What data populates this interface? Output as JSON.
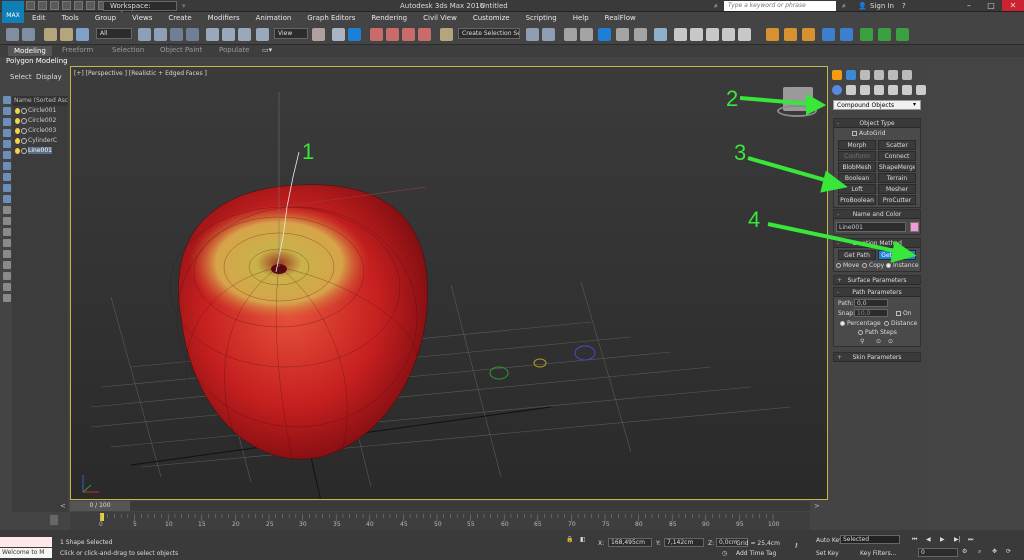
{
  "titlebar": {
    "logo": "MAX",
    "workspace": "Workspace: Default",
    "app_title": "Autodesk 3ds Max 2016",
    "document": "Untitled",
    "search_placeholder": "Type a keyword or phrase",
    "sign_in": "Sign In"
  },
  "menu": [
    "Edit",
    "Tools",
    "Group",
    "Views",
    "Create",
    "Modifiers",
    "Animation",
    "Graph Editors",
    "Rendering",
    "Civil View",
    "Customize",
    "Scripting",
    "Help",
    "RealFlow"
  ],
  "toolbar": {
    "selection_filter": "All",
    "ref_coord": "View",
    "named_selection": "Create Selection Se"
  },
  "ribbon": {
    "tabs": [
      "Modeling",
      "Freeform",
      "Selection",
      "Object Paint",
      "Populate"
    ],
    "active": "Modeling",
    "subtitle": "Polygon Modeling"
  },
  "left_panel": {
    "tabs": [
      "Select",
      "Display"
    ],
    "header": "Name (Sorted Ascen",
    "items": [
      "Circle001",
      "Circle002",
      "Circle003",
      "CylinderC",
      "Line001"
    ],
    "selected_index": 4
  },
  "viewport": {
    "label": "[+] [Perspective ] [Realistic + Edged Faces ]"
  },
  "command_panel": {
    "category": "Compound Objects",
    "object_type": {
      "title": "Object Type",
      "autogrid": "AutoGrid",
      "buttons": [
        "Morph",
        "Scatter",
        "Conform",
        "Connect",
        "BlobMesh",
        "ShapeMerge",
        "Boolean",
        "Terrain",
        "Loft",
        "Mesher",
        "ProBoolean",
        "ProCutter"
      ]
    },
    "name_color": {
      "title": "Name and Color",
      "name": "Line001",
      "color": "#f09ad8"
    },
    "creation_method": {
      "title": "Creation Method",
      "get_path": "Get Path",
      "get_shape": "Get Shape",
      "move": "Move",
      "copy": "Copy",
      "instance": "Instance"
    },
    "surface": "Surface Parameters",
    "path_params": {
      "title": "Path Parameters",
      "path_label": "Path:",
      "path_value": "0,0",
      "snap_label": "Snap:",
      "snap_value": "10,0",
      "on": "On",
      "percentage": "Percentage",
      "distance": "Distance",
      "path_steps": "Path Steps"
    },
    "skin": "Skin Parameters"
  },
  "timeline": {
    "frame": "0 / 100",
    "ticks": [
      "0",
      "5",
      "10",
      "15",
      "20",
      "25",
      "30",
      "35",
      "40",
      "45",
      "50",
      "55",
      "60",
      "65",
      "70",
      "75",
      "80",
      "85",
      "90",
      "95",
      "100"
    ]
  },
  "status": {
    "maxscript": "Welcome to M",
    "selected": "1 Shape Selected",
    "prompt": "Click or click-and-drag to select objects",
    "x_label": "X:",
    "x": "168,495cm",
    "y_label": "Y:",
    "y": "7,142cm",
    "z_label": "Z:",
    "z": "0,0cm",
    "grid": "Grid = 25,4cm",
    "add_time_tag": "Add Time Tag",
    "auto_key": "Auto Key",
    "auto_key_value": "Selected",
    "set_key": "Set Key",
    "key_filters": "Key Filters...",
    "frame_field": "0"
  },
  "annotations": [
    "1",
    "2",
    "3",
    "4"
  ]
}
